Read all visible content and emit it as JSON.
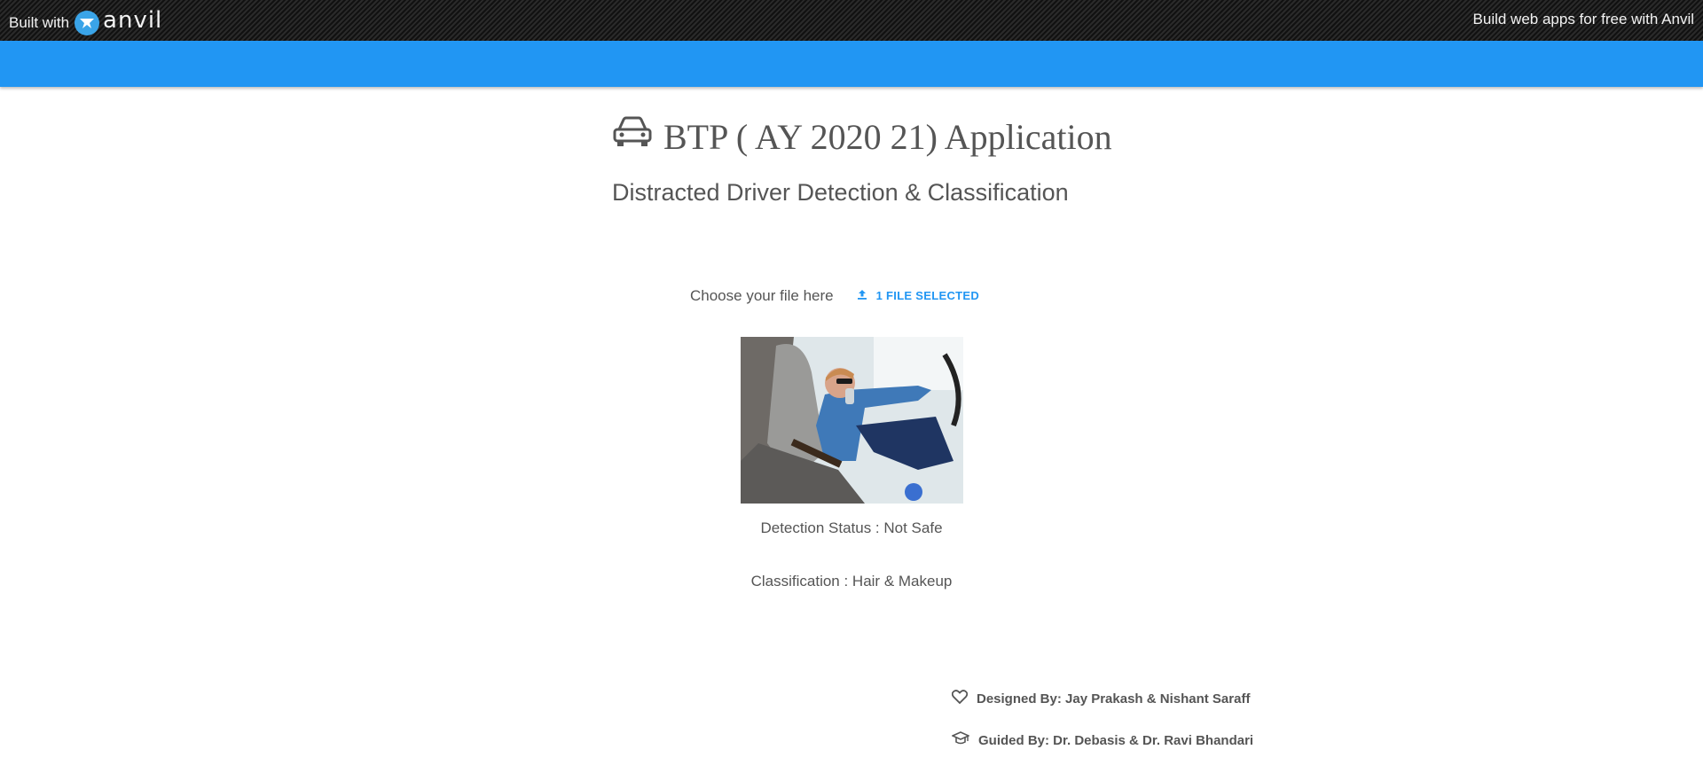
{
  "banner": {
    "built_with": "Built with",
    "logo_text": "anvil",
    "promo": "Build web apps for free with Anvil"
  },
  "header": {
    "title": "BTP ( AY 2020 21) Application",
    "title_icon": "car-icon",
    "subtitle": "Distracted Driver Detection & Classification"
  },
  "upload": {
    "label": "Choose your file here",
    "button_label": "1 FILE SELECTED",
    "button_icon": "upload-icon"
  },
  "results": {
    "detection": "Detection Status : Not Safe",
    "classification": "Classification : Hair & Makeup"
  },
  "credits": {
    "designed": "Designed By: Jay Prakash & Nishant Saraff",
    "designed_icon": "heart-icon",
    "guided": "Guided By: Dr. Debasis & Dr. Ravi Bhandari",
    "guided_icon": "graduation-cap-icon"
  },
  "colors": {
    "accent": "#2196f3",
    "banner_bg": "#1a1a1a"
  }
}
